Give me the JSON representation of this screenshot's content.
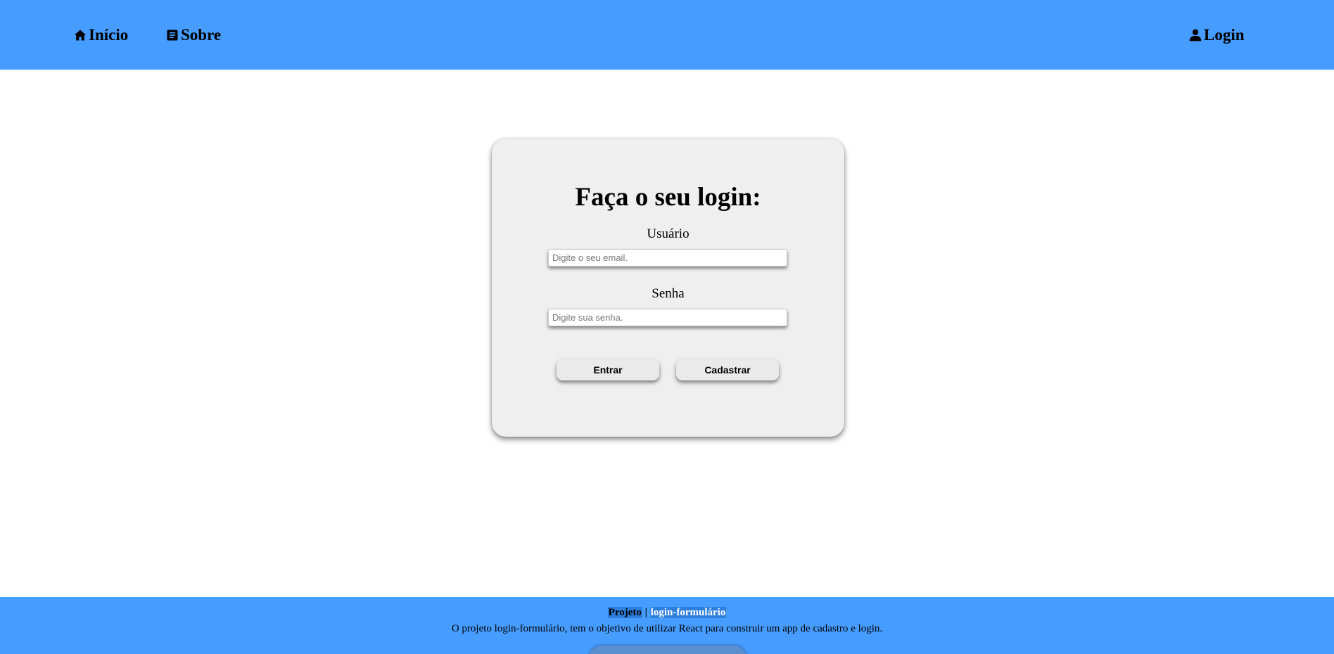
{
  "nav": {
    "home_label": "Início",
    "home_icon": "home-icon",
    "about_label": "Sobre",
    "about_icon": "document-icon",
    "login_label": "Login",
    "login_icon": "user-icon"
  },
  "login_form": {
    "title": "Faça o seu login:",
    "user_label": "Usuário",
    "user_placeholder": "Digite o seu email.",
    "password_label": "Senha",
    "password_placeholder": "Digite sua senha.",
    "enter_button": "Entrar",
    "register_button": "Cadastrar"
  },
  "footer": {
    "project_label": "Projeto",
    "separator": "|",
    "project_name": "login-formulário",
    "description": "O projeto login-formulário, tem o objetivo de utilizar React para construir um app de cadastro e login."
  },
  "colors": {
    "header_bg": "#469cff",
    "footer_bg": "#469cff",
    "card_bg": "#efefef"
  }
}
